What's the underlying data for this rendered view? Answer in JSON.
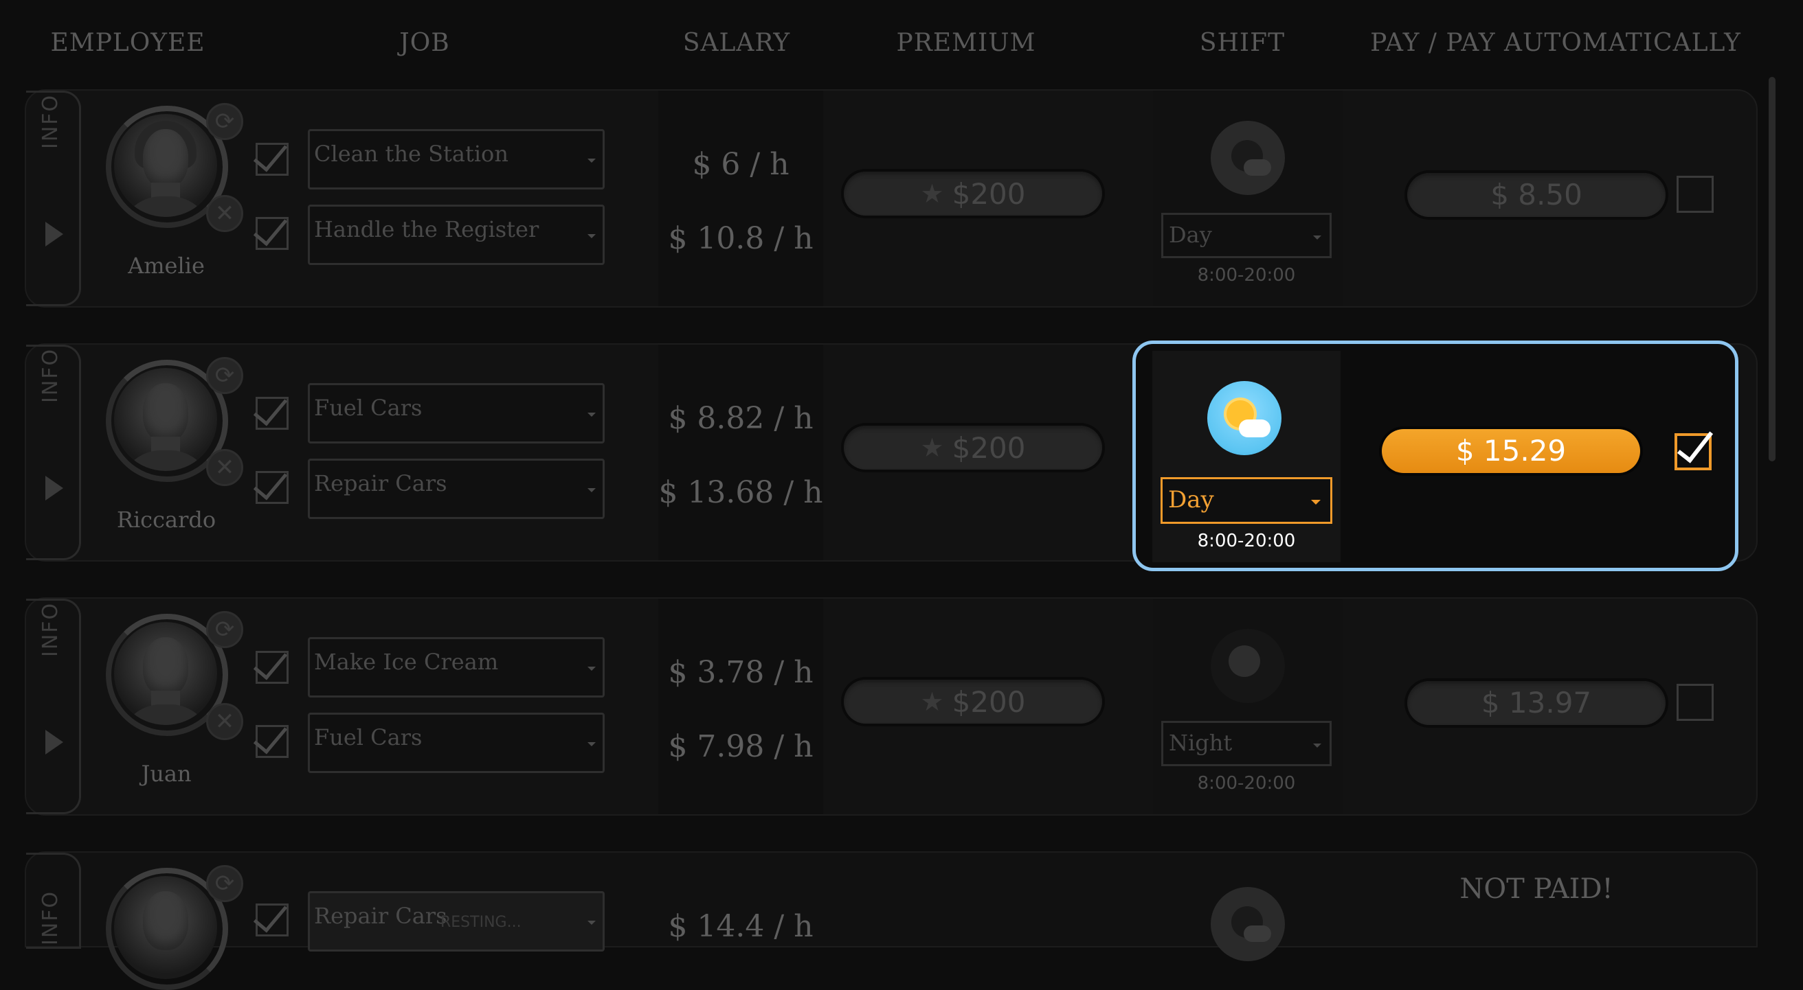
{
  "headers": [
    "EMPLOYEE",
    "JOB",
    "SALARY",
    "PREMIUM",
    "SHIFT",
    "PAY / PAY AUTOMATICALLY"
  ],
  "info_label": "INFO",
  "employees": [
    {
      "name": "Amelie",
      "jobs": [
        "Clean the Station",
        "Handle the Register"
      ],
      "salaries": [
        "$ 6 / h",
        "$ 10.8 / h"
      ],
      "premium": "$200",
      "shift": "Day",
      "shift_time": "8:00-20:00",
      "pay": "$ 8.50"
    },
    {
      "name": "Riccardo",
      "jobs": [
        "Fuel Cars",
        "Repair Cars"
      ],
      "salaries": [
        "$ 8.82 / h",
        "$ 13.68 / h"
      ],
      "premium": "$200",
      "shift": "Day",
      "shift_time": "8:00-20:00",
      "pay": "$ 15.29"
    },
    {
      "name": "Juan",
      "jobs": [
        "Make Ice Cream",
        "Fuel Cars"
      ],
      "salaries": [
        "$ 3.78 / h",
        "$ 7.98 / h"
      ],
      "premium": "$200",
      "shift": "Night",
      "shift_time": "8:00-20:00",
      "pay": "$ 13.97"
    },
    {
      "jobs": [
        "Repair Cars"
      ],
      "resting": "RESTING...",
      "salaries": [
        "$ 14.4 / h"
      ],
      "pay_status": "NOT PAID!"
    }
  ],
  "colors": {
    "accent": "#f09a2a",
    "highlight_border": "#8ec6f0"
  }
}
